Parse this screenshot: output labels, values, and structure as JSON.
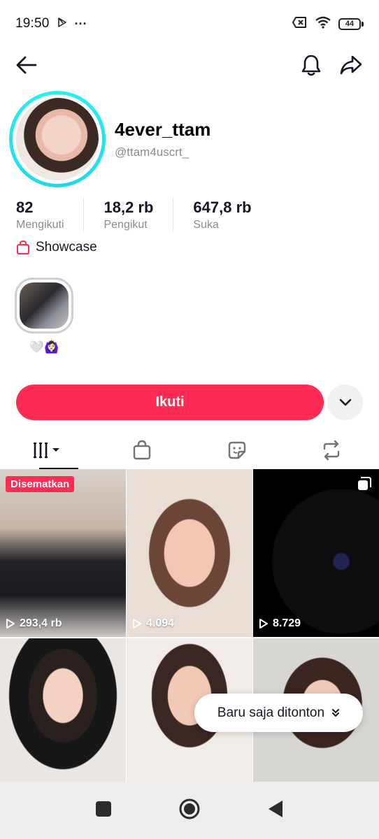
{
  "status_bar": {
    "time": "19:50",
    "more": "···",
    "battery": "44"
  },
  "profile": {
    "display_name": "4ever_ttam",
    "username": "@ttam4uscrt_"
  },
  "stats": [
    {
      "value": "82",
      "label": "Mengikuti"
    },
    {
      "value": "18,2 rb",
      "label": "Pengikut"
    },
    {
      "value": "647,8 rb",
      "label": "Suka"
    }
  ],
  "showcase": {
    "label": "Showcase"
  },
  "highlight": {
    "label": "🤍🙆🏻‍♀️"
  },
  "actions": {
    "follow_label": "Ikuti"
  },
  "videos": [
    {
      "badge": "Disematkan",
      "views": "293,4 rb"
    },
    {
      "views": "4.094"
    },
    {
      "views": "8.729"
    }
  ],
  "toast": {
    "label": "Baru saja ditonton"
  },
  "colors": {
    "accent": "#fe2c55",
    "ring": "#25f4ee"
  }
}
